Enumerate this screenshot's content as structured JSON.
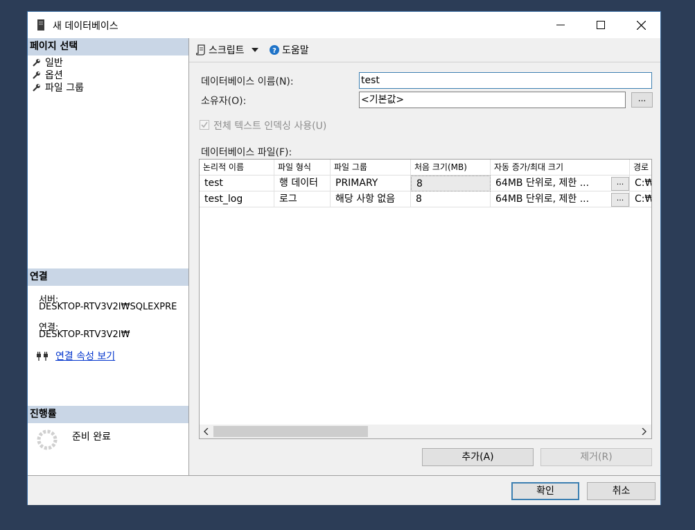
{
  "window": {
    "title": "새 데이터베이스"
  },
  "left": {
    "page_select_header": "페이지 선택",
    "nav_items": [
      {
        "label": "일반"
      },
      {
        "label": "옵션"
      },
      {
        "label": "파일 그룹"
      }
    ],
    "connection_header": "연결",
    "server_label": "서버:",
    "server_value": "DESKTOP-RTV3V2I₩SQLEXPRE",
    "connection_label": "연결:",
    "connection_value": "DESKTOP-RTV3V2I₩",
    "view_connection_link": "연결 속성 보기",
    "progress_header": "진행률",
    "progress_status": "준비 완료"
  },
  "toolbar": {
    "script_label": "스크립트",
    "help_label": "도움말"
  },
  "form": {
    "db_name_label": "데이터베이스 이름(N):",
    "db_name_value": "test",
    "owner_label": "소유자(O):",
    "owner_value": "<기본값>",
    "browse_label": "...",
    "fulltext_label": "전체 텍스트 인덱싱 사용(U)",
    "db_files_label": "데이터베이스 파일(F):"
  },
  "grid": {
    "headers": [
      "논리적 이름",
      "파일 형식",
      "파일 그룹",
      "처음 크기(MB)",
      "자동 증가/최대 크기",
      "경로"
    ],
    "rows": [
      [
        "test",
        "행 데이터",
        "PRIMARY",
        "8",
        "64MB 단위로, 제한 ...",
        "C:₩"
      ],
      [
        "test_log",
        "로그",
        "해당 사항 없음",
        "8",
        "64MB 단위로, 제한 ...",
        "C:₩"
      ]
    ],
    "cell_button_label": "..."
  },
  "buttons": {
    "add": "추가(A)",
    "remove": "제거(R)",
    "ok": "확인",
    "cancel": "취소"
  }
}
